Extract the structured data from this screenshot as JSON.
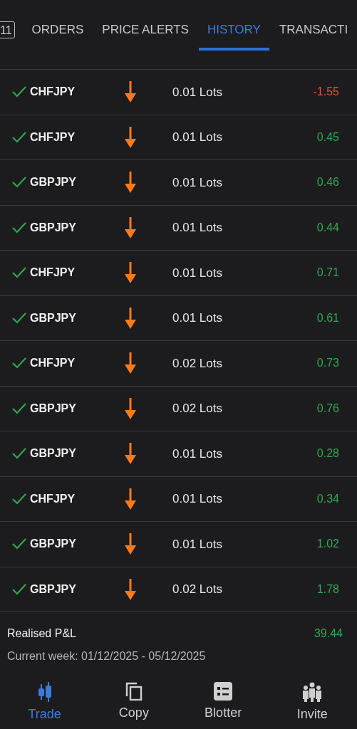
{
  "tabs": [
    {
      "label": "11",
      "kind": "count",
      "selected": false
    },
    {
      "label": "ORDERS",
      "kind": "text",
      "selected": false
    },
    {
      "label": "PRICE ALERTS",
      "kind": "text",
      "selected": false
    },
    {
      "label": "HISTORY",
      "kind": "text",
      "selected": true
    },
    {
      "label": "TRANSACTI",
      "kind": "text",
      "selected": false
    }
  ],
  "trades": [
    {
      "symbol": "CHFJPY",
      "kind": "down",
      "size": "0.01 Lots",
      "pnl": "-1.55",
      "color": "#e0552e"
    },
    {
      "symbol": "CHFJPY",
      "kind": "down",
      "size": "0.01 Lots",
      "pnl": "0.45",
      "color": "#2fa84f"
    },
    {
      "symbol": "GBPJPY",
      "kind": "down",
      "size": "0.01 Lots",
      "pnl": "0.46",
      "color": "#2fa84f"
    },
    {
      "symbol": "GBPJPY",
      "kind": "down",
      "size": "0.01 Lots",
      "pnl": "0.44",
      "color": "#2fa84f"
    },
    {
      "symbol": "CHFJPY",
      "kind": "down",
      "size": "0.01 Lots",
      "pnl": "0.71",
      "color": "#2fa84f"
    },
    {
      "symbol": "GBPJPY",
      "kind": "down",
      "size": "0.01 Lots",
      "pnl": "0.61",
      "color": "#2fa84f"
    },
    {
      "symbol": "CHFJPY",
      "kind": "down",
      "size": "0.02 Lots",
      "pnl": "0.73",
      "color": "#2fa84f"
    },
    {
      "symbol": "GBPJPY",
      "kind": "down",
      "size": "0.02 Lots",
      "pnl": "0.76",
      "color": "#2fa84f"
    },
    {
      "symbol": "GBPJPY",
      "kind": "down",
      "size": "0.01 Lots",
      "pnl": "0.28",
      "color": "#2fa84f"
    },
    {
      "symbol": "CHFJPY",
      "kind": "down",
      "size": "0.01 Lots",
      "pnl": "0.34",
      "color": "#2fa84f"
    },
    {
      "symbol": "GBPJPY",
      "kind": "down",
      "size": "0.01 Lots",
      "pnl": "1.02",
      "color": "#2fa84f"
    },
    {
      "symbol": "GBPJPY",
      "kind": "down",
      "size": "0.02 Lots",
      "pnl": "1.78",
      "color": "#2fa84f"
    }
  ],
  "summary": {
    "label": "Realised P&L",
    "value": "39.44",
    "period": "Current week: 01/12/2025 - 05/12/2025"
  },
  "bottom_nav": [
    {
      "label": "Trade",
      "kind": "candles",
      "selected": true
    },
    {
      "label": "Copy",
      "kind": "copy",
      "selected": false
    },
    {
      "label": "Blotter",
      "kind": "list",
      "selected": false
    },
    {
      "label": "Invite",
      "kind": "people",
      "selected": false
    }
  ]
}
